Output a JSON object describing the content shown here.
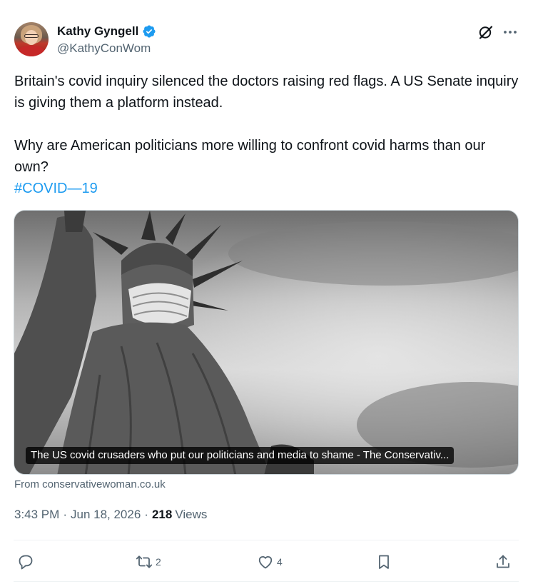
{
  "author": {
    "name": "Kathy Gyngell",
    "handle": "@KathyConWom"
  },
  "tweet": {
    "paragraph1": "Britain's covid inquiry silenced the doctors raising red flags. A US Senate inquiry is giving them a platform instead.",
    "paragraph2": "Why are American politicians more willing to confront covid harms than our own?",
    "hashtag": "#COVID—19"
  },
  "card": {
    "caption": "The US covid crusaders who put our politicians and media to shame - The Conservativ...",
    "source": "From conservativewoman.co.uk"
  },
  "meta": {
    "time": "3:43 PM",
    "separator": "·",
    "date": "Jun 18, 2026",
    "views_count": "218",
    "views_label": "Views"
  },
  "actions": {
    "reply_count": "",
    "retweet_count": "2",
    "like_count": "4"
  },
  "icons": {
    "verified": "verified-badge-icon",
    "grok": "grok-icon",
    "more": "more-icon",
    "reply": "reply-icon",
    "retweet": "retweet-icon",
    "like": "heart-icon",
    "bookmark": "bookmark-icon",
    "share": "share-icon"
  },
  "colors": {
    "accent": "#1d9bf0",
    "text": "#0f1419",
    "muted": "#536471"
  }
}
